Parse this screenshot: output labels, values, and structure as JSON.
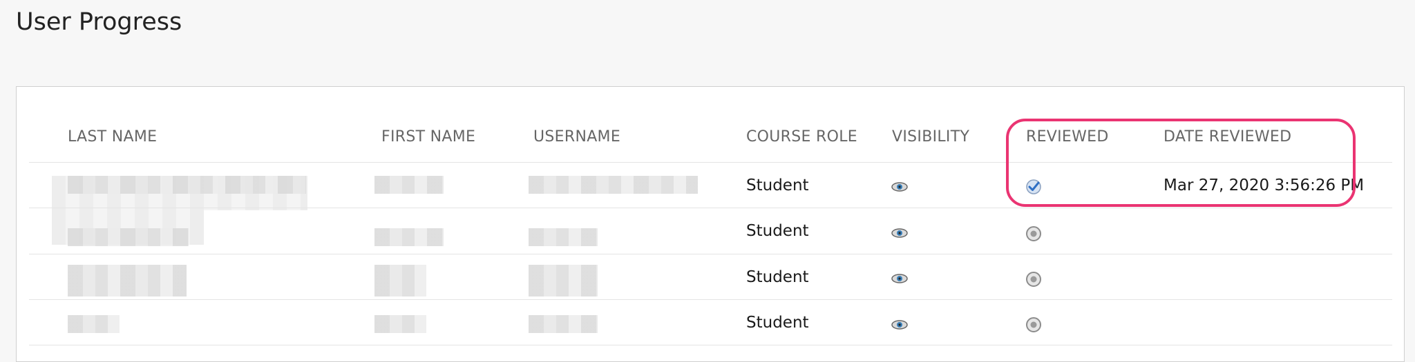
{
  "page": {
    "title": "User Progress"
  },
  "table": {
    "headers": {
      "last_name": "LAST NAME",
      "first_name": "FIRST NAME",
      "username": "USERNAME",
      "course_role": "COURSE ROLE",
      "visibility": "VISIBILITY",
      "reviewed": "REVIEWED",
      "date_reviewed": "DATE REVIEWED"
    },
    "rows": [
      {
        "course_role": "Student",
        "visibility_icon": "eye-icon",
        "reviewed": true,
        "reviewed_icon": "checkmark-icon",
        "date_reviewed": "Mar 27, 2020 3:56:26 PM"
      },
      {
        "course_role": "Student",
        "visibility_icon": "eye-icon",
        "reviewed": false,
        "reviewed_icon": "radio-icon",
        "date_reviewed": ""
      },
      {
        "course_role": "Student",
        "visibility_icon": "eye-icon",
        "reviewed": false,
        "reviewed_icon": "radio-icon",
        "date_reviewed": ""
      },
      {
        "course_role": "Student",
        "visibility_icon": "eye-icon",
        "reviewed": false,
        "reviewed_icon": "radio-icon",
        "date_reviewed": ""
      }
    ]
  },
  "colors": {
    "highlight": "#ea3472",
    "check_blue": "#2f6fc4"
  }
}
